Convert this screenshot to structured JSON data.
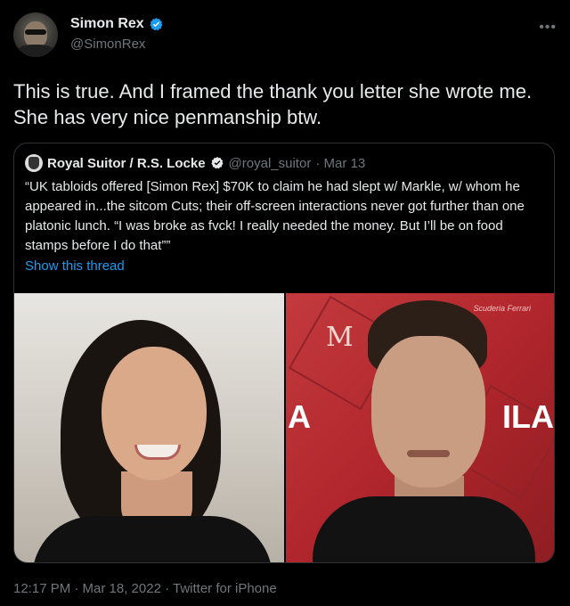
{
  "tweet": {
    "author_name": "Simon Rex",
    "author_handle": "@SimonRex",
    "more_icon": "more-horizontal-icon",
    "text": "This is true. And I framed the thank you letter she wrote me. She has very nice penmanship btw.",
    "timestamp": "12:17 PM · Mar 18, 2022 · Twitter for iPhone"
  },
  "quote": {
    "author_name": "Royal Suitor / R.S. Locke",
    "author_handle": "@royal_suitor",
    "date_sep": "· Mar 13",
    "text": "“UK tabloids offered [Simon Rex] $70K to claim he had slept w/ Markle, w/ whom he appeared in...the sitcom Cuts; their off-screen interactions never got further than one platonic lunch. “I was broke as fvck! I really needed the money. But I’ll be on food stamps before I do that””",
    "show_thread": "Show this thread",
    "photo_right_texts": {
      "m": "M",
      "a": "A",
      "la": "ILA",
      "sponsor": "Scuderia Ferrari"
    }
  },
  "colors": {
    "background": "#000000",
    "text": "#e7e9ea",
    "muted": "#71767b",
    "link": "#1d9bf0",
    "border": "#2f3336",
    "verified": "#1d9bf0"
  }
}
